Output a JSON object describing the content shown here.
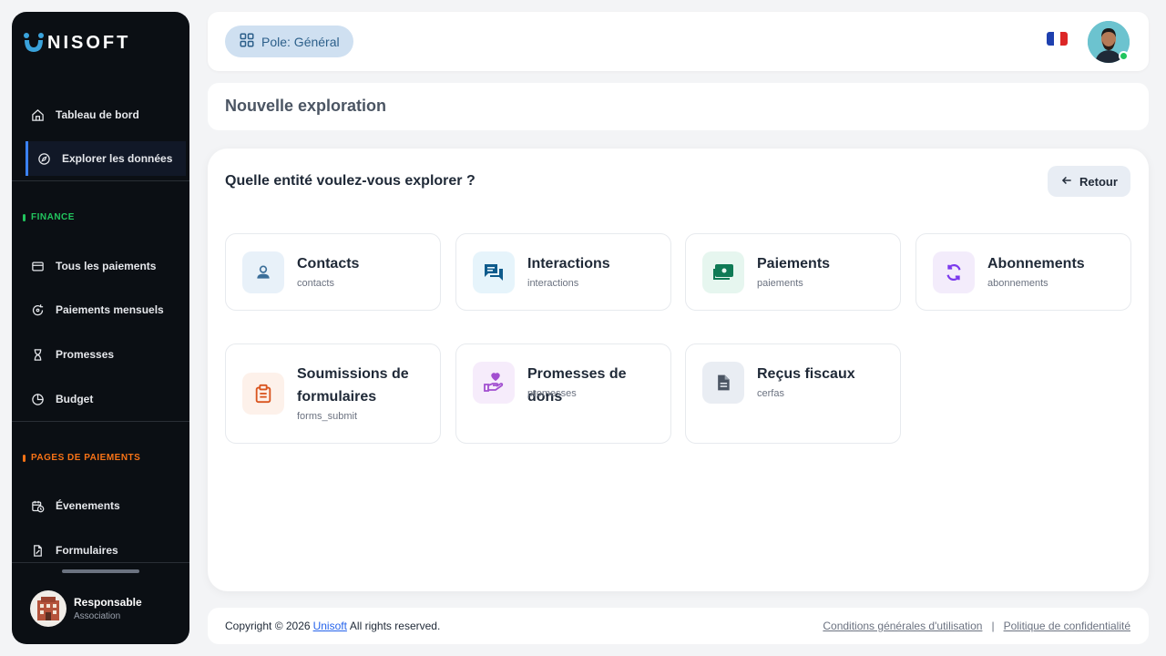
{
  "brand": {
    "name": "NISOFT",
    "mark_color": "#3aa3dc"
  },
  "sidebar": {
    "items_top": [
      {
        "label": "Tableau de bord",
        "icon": "home-icon"
      },
      {
        "label": "Explorer les données",
        "icon": "compass-icon",
        "active": true
      }
    ],
    "sections": [
      {
        "label": "FINANCE",
        "color": "#22c55e",
        "items": [
          {
            "label": "Tous les paiements",
            "icon": "credit-card-icon"
          },
          {
            "label": "Paiements mensuels",
            "icon": "refresh-icon"
          },
          {
            "label": "Promesses",
            "icon": "hourglass-icon"
          },
          {
            "label": "Budget",
            "icon": "pie-chart-icon"
          }
        ]
      },
      {
        "label": "PAGES DE PAIEMENTS",
        "color": "#f97316",
        "items": [
          {
            "label": "Évenements",
            "icon": "calendar-clock-icon"
          },
          {
            "label": "Formulaires",
            "icon": "document-edit-icon"
          }
        ]
      }
    ],
    "profile": {
      "name": "Responsable",
      "role": "Association"
    }
  },
  "topbar": {
    "pole_label": "Pole: Général",
    "language": "fr-flag-icon"
  },
  "page_title": "Nouvelle exploration",
  "main": {
    "question": "Quelle entité voulez-vous explorer ?",
    "back_label": "Retour",
    "entities": [
      {
        "title": "Contacts",
        "key": "contacts",
        "icon": "user-icon",
        "bg": "#e8f1f9",
        "color": "#3b6e99"
      },
      {
        "title": "Interactions",
        "key": "interactions",
        "icon": "chat-icon",
        "bg": "#e6f4fb",
        "color": "#0e5b8c"
      },
      {
        "title": "Paiements",
        "key": "paiements",
        "icon": "banknote-icon",
        "bg": "#e6f6ef",
        "color": "#0f7a55"
      },
      {
        "title": "Abonnements",
        "key": "abonnements",
        "icon": "sync-icon",
        "bg": "#f3ecfb",
        "color": "#7c3aed"
      },
      {
        "title": "Soumissions de formulaires",
        "key": "forms_submit",
        "icon": "clipboard-icon",
        "bg": "#fdf1ea",
        "color": "#d9541e"
      },
      {
        "title": "Promesses de dons",
        "key": "promesses",
        "icon": "heart-hand-icon",
        "bg": "#f6ecfb",
        "color": "#a24fd0"
      },
      {
        "title": "Reçus fiscaux",
        "key": "cerfas",
        "icon": "file-text-icon",
        "bg": "#e9edf3",
        "color": "#4b5563"
      }
    ]
  },
  "footer": {
    "copyright_prefix": "Copyright © 2026",
    "company_link": "Unisoft",
    "copyright_suffix": "All rights reserved.",
    "terms": "Conditions générales d'utilisation",
    "separator": "|",
    "privacy": "Politique de confidentialité"
  }
}
